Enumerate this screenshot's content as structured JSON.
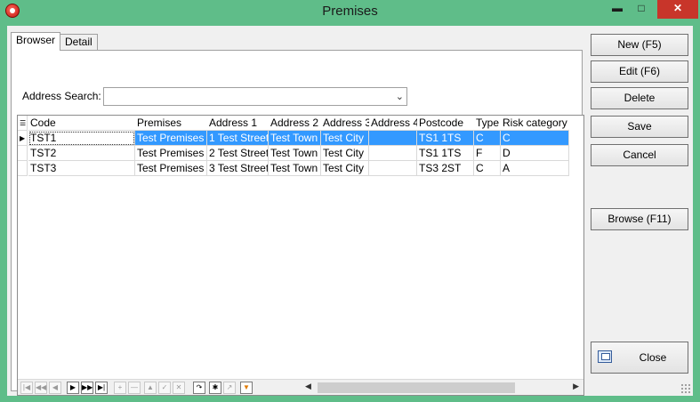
{
  "window": {
    "title": "Premises",
    "controls": {
      "minimize": "▬",
      "maximize": "□",
      "close": "✕"
    }
  },
  "tabs": [
    {
      "label": "Browser",
      "active": true
    },
    {
      "label": "Detail",
      "active": false
    }
  ],
  "search": {
    "label": "Address Search:",
    "value": ""
  },
  "grid": {
    "columns": [
      "Code",
      "Premises",
      "Address 1",
      "Address 2",
      "Address 3",
      "Address 4",
      "Postcode",
      "Type",
      "Risk category"
    ],
    "rows": [
      {
        "code": "TST1",
        "premises": "Test Premises",
        "address1": "1 Test Street",
        "address2": "Test Town",
        "address3": "Test City",
        "address4": "",
        "postcode": "TS1 1TS",
        "type": "C",
        "risk": "C",
        "selected": true
      },
      {
        "code": "TST2",
        "premises": "Test Premises 2",
        "address1": "2 Test Street",
        "address2": "Test Town",
        "address3": "Test City",
        "address4": "",
        "postcode": "TS1 1TS",
        "type": "F",
        "risk": "D",
        "selected": false
      },
      {
        "code": "TST3",
        "premises": "Test Premises 3",
        "address1": "3 Test Street",
        "address2": "Test Town",
        "address3": "Test City",
        "address4": "",
        "postcode": "TS3 2ST",
        "type": "C",
        "risk": "A",
        "selected": false
      }
    ]
  },
  "navigator": {
    "buttons": [
      "first-icon",
      "prev-page-icon",
      "prev-icon",
      "next-icon",
      "next-page-icon",
      "last-icon",
      "insert-icon",
      "delete-icon",
      "up-icon",
      "post-icon",
      "cancel-icon",
      "refresh-icon",
      "bookmark-icon",
      "goto-bookmark-icon",
      "filter-icon"
    ]
  },
  "actions": {
    "new": "New (F5)",
    "edit": "Edit (F6)",
    "delete": "Delete",
    "save": "Save",
    "cancel": "Cancel",
    "browse": "Browse (F11)",
    "close": "Close"
  },
  "colors": {
    "titlebar": "#5fbd89",
    "selection": "#3399ff",
    "close_button": "#c8352a"
  }
}
